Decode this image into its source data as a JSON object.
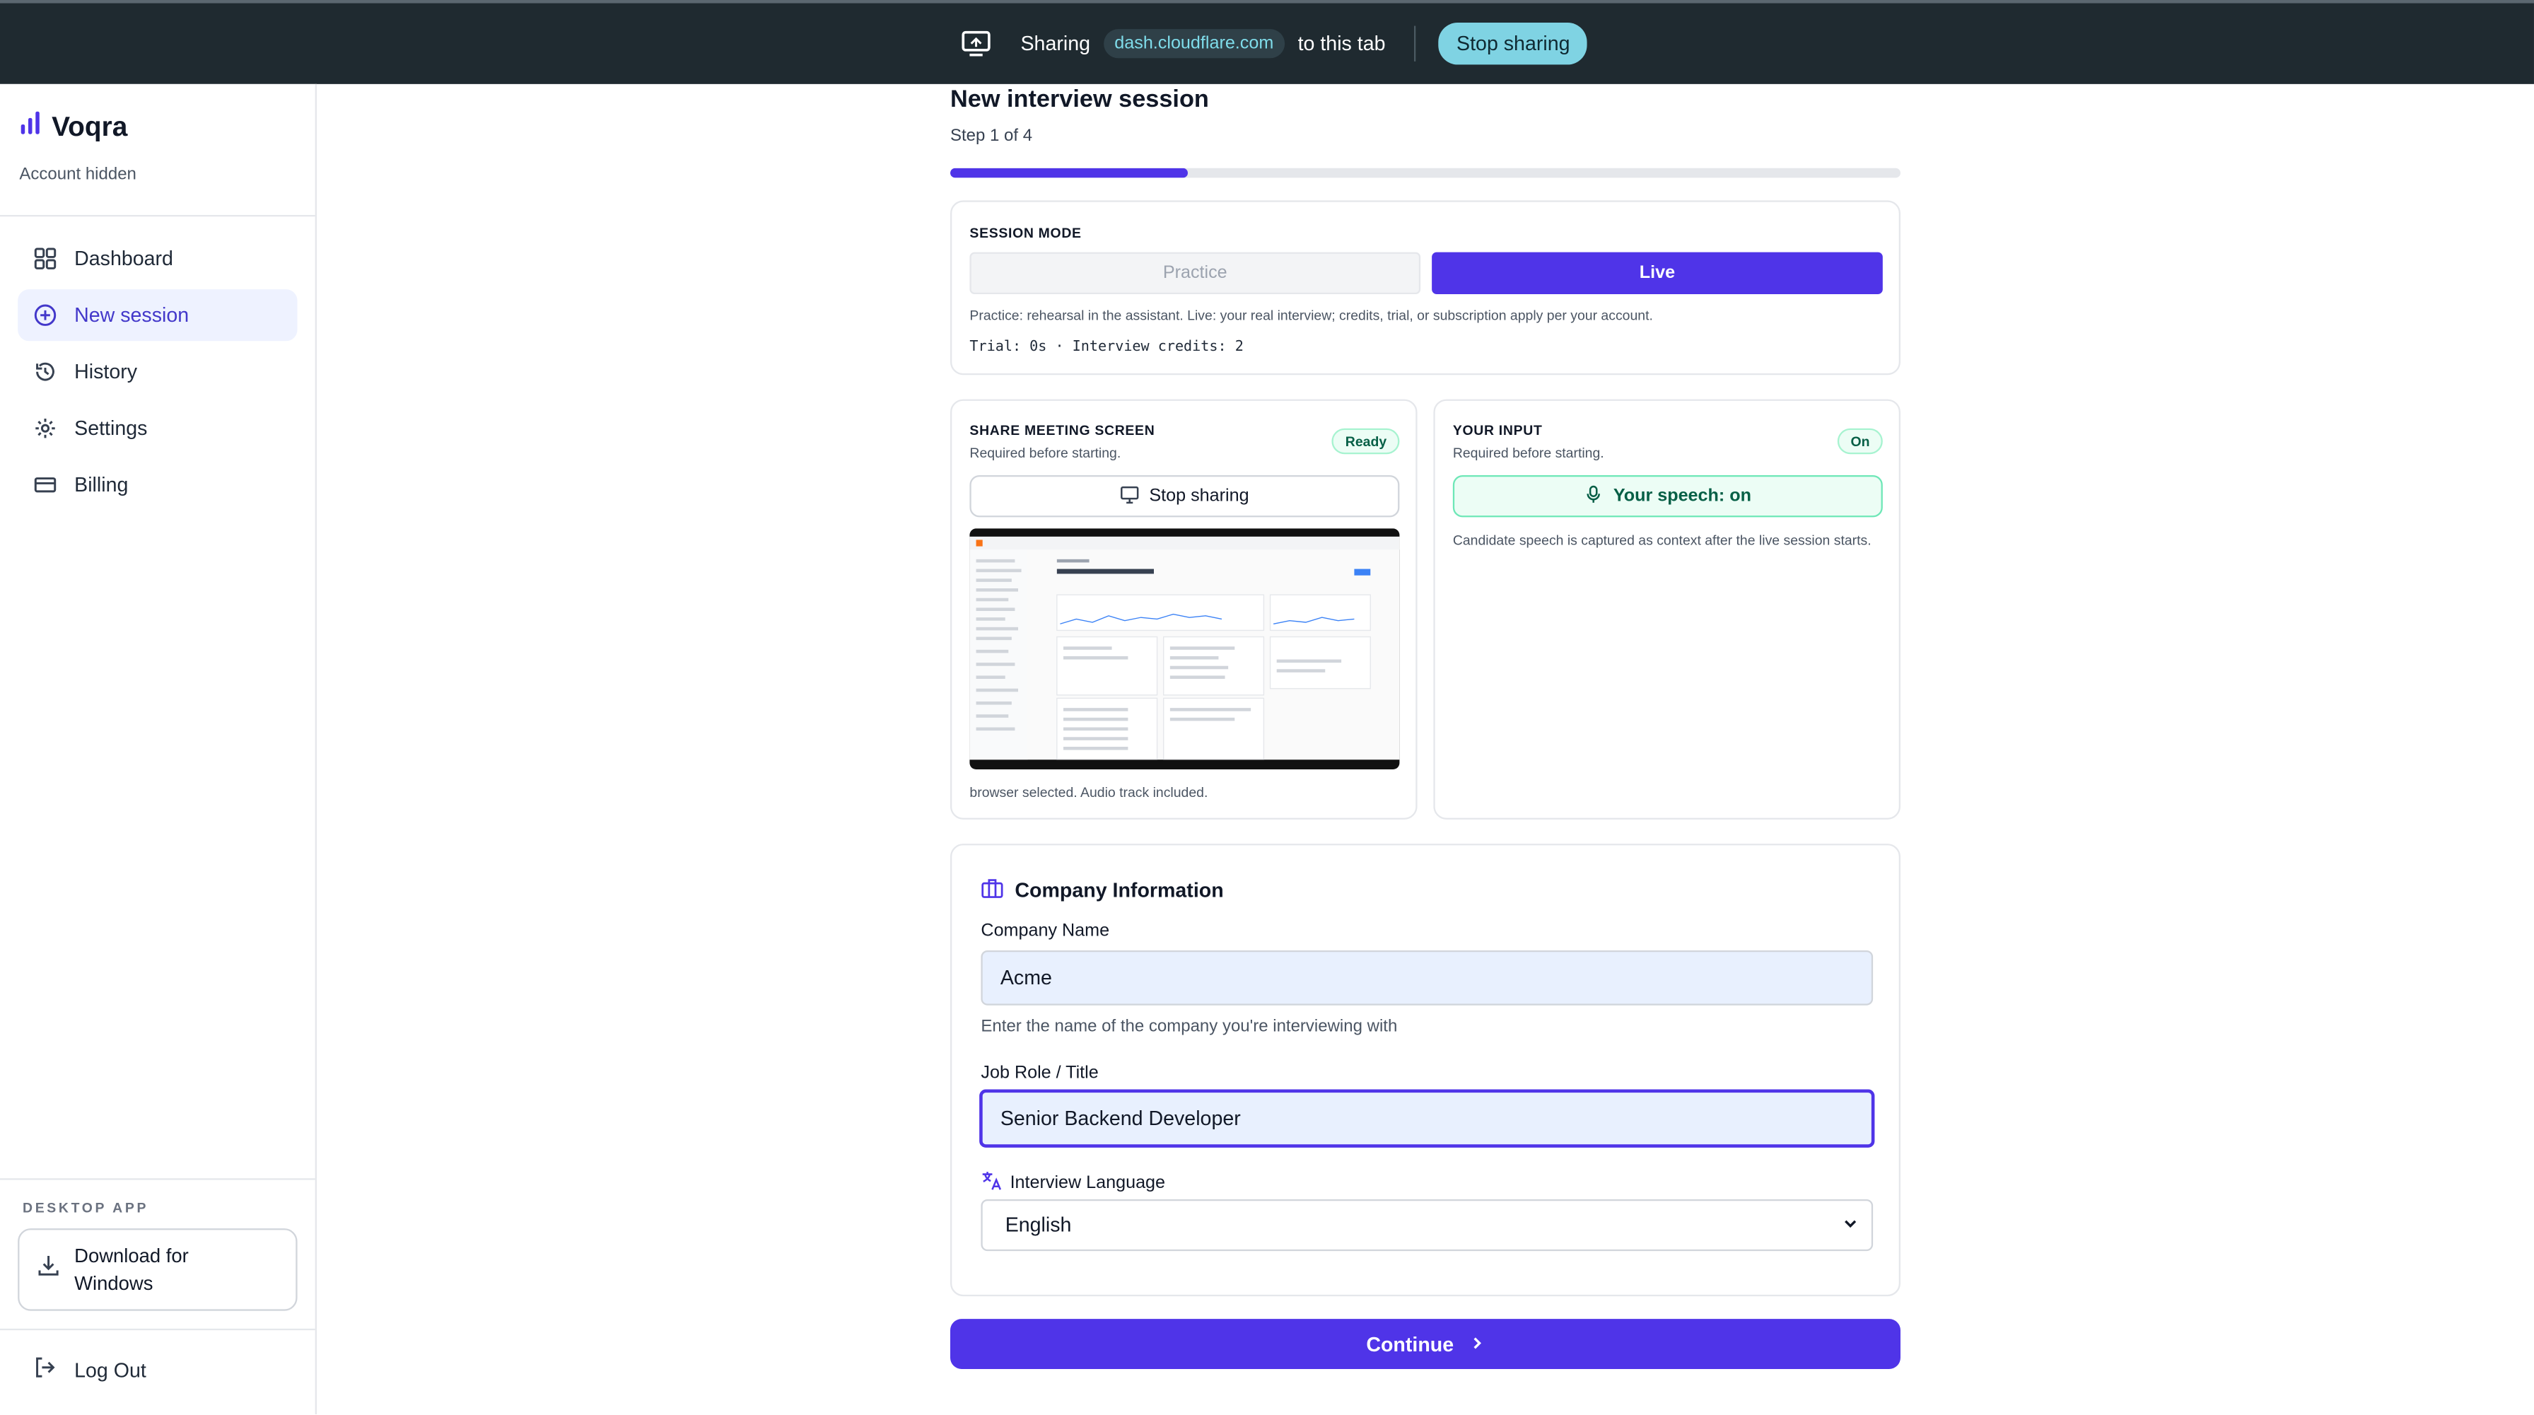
{
  "share_bar": {
    "sharing_label": "Sharing",
    "host": "dash.cloudflare.com",
    "suffix": "to this tab",
    "stop_label": "Stop sharing"
  },
  "sidebar": {
    "brand": "Voqra",
    "account": "Account hidden",
    "items": [
      {
        "label": "Dashboard",
        "icon": "dashboard-icon"
      },
      {
        "label": "New session",
        "icon": "plus-circle-icon",
        "active": true
      },
      {
        "label": "History",
        "icon": "history-icon"
      },
      {
        "label": "Settings",
        "icon": "gear-icon"
      },
      {
        "label": "Billing",
        "icon": "credit-card-icon"
      }
    ],
    "desktop_label": "DESKTOP APP",
    "download_label": "Download for Windows",
    "logout_label": "Log Out"
  },
  "main": {
    "title": "New interview session",
    "step": "Step 1 of 4",
    "progress": 0.25
  },
  "session_mode": {
    "label": "SESSION MODE",
    "practice": "Practice",
    "live": "Live",
    "selected": "Live",
    "description": "Practice: rehearsal in the assistant. Live: your real interview; credits, trial, or subscription apply per your account.",
    "trial": "Trial: 0s · Interview credits: 2"
  },
  "share_screen": {
    "label": "SHARE MEETING SCREEN",
    "required": "Required before starting.",
    "badge": "Ready",
    "button": "Stop sharing",
    "caption": "browser selected. Audio track included."
  },
  "your_input": {
    "label": "YOUR INPUT",
    "required": "Required before starting.",
    "badge": "On",
    "button": "Your speech: on",
    "description": "Candidate speech is captured as context after the live session starts."
  },
  "company": {
    "title": "Company Information",
    "company_label": "Company Name",
    "company_value": "Acme",
    "company_help": "Enter the name of the company you're interviewing with",
    "role_label": "Job Role / Title",
    "role_value": "Senior Backend Developer",
    "language_label": "Interview Language",
    "language_value": "English"
  },
  "continue_label": "Continue",
  "colors": {
    "accent": "#4f34e8",
    "share_bar": "#1f2a30",
    "success": "#065f46"
  }
}
